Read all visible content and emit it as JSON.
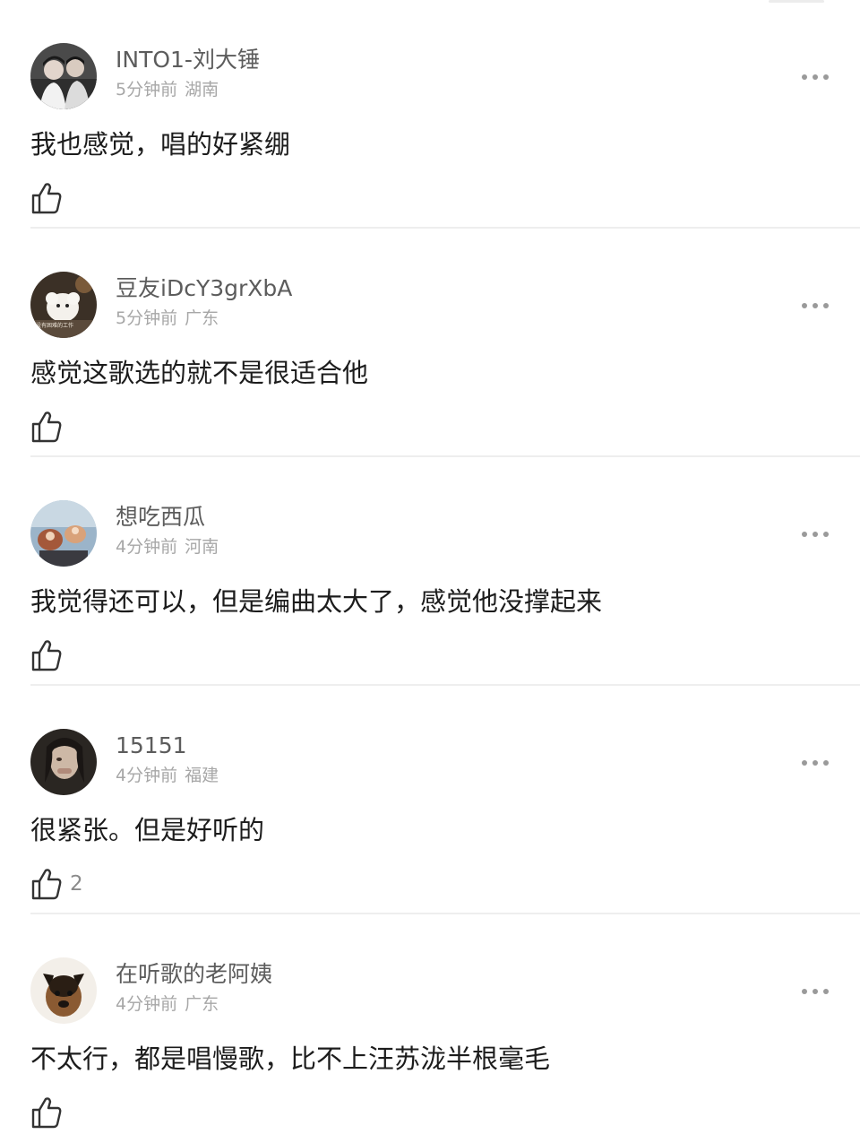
{
  "comments": [
    {
      "username": "INTO1-刘大锤",
      "time": "5分钟前",
      "location": "湖南",
      "text": "我也感觉，唱的好紧绷",
      "likes": ""
    },
    {
      "username": "豆友iDcY3grXbA",
      "time": "5分钟前",
      "location": "广东",
      "text": "感觉这歌选的就不是很适合他",
      "likes": ""
    },
    {
      "username": "想吃西瓜",
      "time": "4分钟前",
      "location": "河南",
      "text": "我觉得还可以，但是编曲太大了，感觉他没撑起来",
      "likes": ""
    },
    {
      "username": "15151",
      "time": "4分钟前",
      "location": "福建",
      "text": "很紧张。但是好听的",
      "likes": "2"
    },
    {
      "username": "在听歌的老阿姨",
      "time": "4分钟前",
      "location": "广东",
      "text": "不太行，都是唱慢歌，比不上汪苏泷半根毫毛",
      "likes": ""
    }
  ],
  "icons": {
    "like": "thumbs-up-icon",
    "more": "more-dots-icon"
  },
  "colors": {
    "username": "#5c5c5c",
    "meta": "#a7a7a7",
    "text": "#1c1c1c",
    "divider": "#eeeeee"
  }
}
